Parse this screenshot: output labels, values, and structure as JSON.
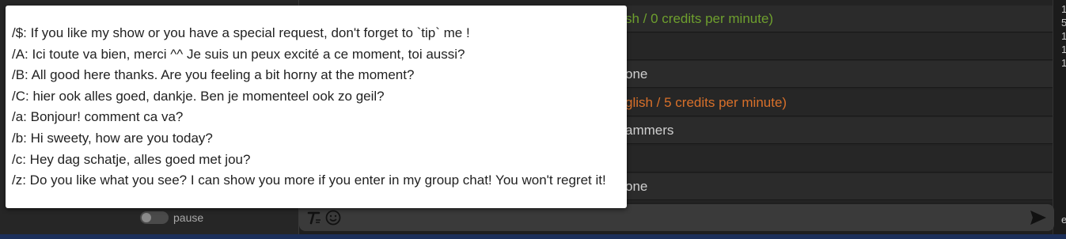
{
  "chat_rows": [
    {
      "text": "sh / 0 credits per minute)",
      "style": "green"
    },
    {
      "text": "",
      "style": "white"
    },
    {
      "text": "one",
      "style": "white"
    },
    {
      "text": "glish / 5 credits per minute)",
      "style": "orange"
    },
    {
      "text": "ammers",
      "style": "white"
    },
    {
      "text": "",
      "style": "white"
    },
    {
      "text": "one",
      "style": "white"
    }
  ],
  "right_gutter": [
    "1",
    "5",
    "1",
    "1",
    "1"
  ],
  "right_edge_char": "e",
  "left_panel": {
    "pause_label": "pause"
  },
  "shortcuts": [
    {
      "line": "/$: If you like my show or you have a special request, don't forget to `tip` me !"
    },
    {
      "line": "/A: Ici toute va bien, merci ^^ Je suis un peux excité a ce moment, toi aussi?"
    },
    {
      "line": "/B: All good here thanks. Are you feeling a bit horny at the moment?"
    },
    {
      "line": "/C: hier ook alles goed, dankje. Ben je momenteel ook zo geil?"
    },
    {
      "line": "/a: Bonjour! comment ca va?"
    },
    {
      "line": "/b: Hi sweety, how are you today?"
    },
    {
      "line": "/c: Hey dag schatje, alles goed met jou?"
    },
    {
      "line": "/z: Do you like what you see? I can show you more if you enter in my group chat! You won't regret it!"
    }
  ],
  "input_bar": {
    "format_icon": "text-format-icon",
    "emoji_icon": "emoji-icon",
    "send_icon": "send-icon"
  },
  "colors": {
    "green": "#6e9f2e",
    "orange": "#d8702a",
    "popup_bg": "#ffffff"
  }
}
